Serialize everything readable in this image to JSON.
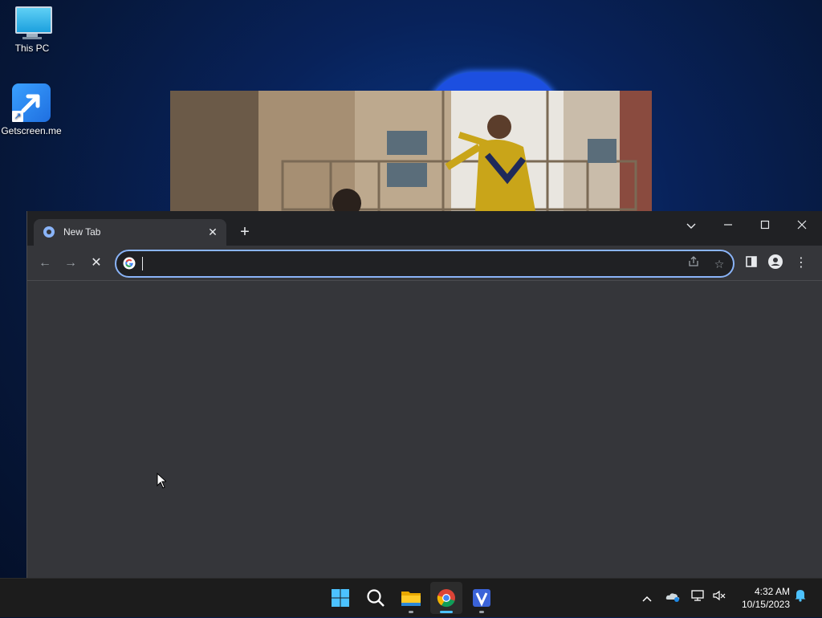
{
  "desktop": {
    "icons": [
      {
        "label": "This PC",
        "icon": "monitor-icon"
      },
      {
        "label": "Getscreen.me",
        "icon": "getscreen-arrow-icon"
      }
    ]
  },
  "browser": {
    "tab": {
      "title": "New Tab",
      "favicon": "chrome-newtab-icon",
      "close_glyph": "✕"
    },
    "new_tab_glyph": "+",
    "window_controls": {
      "tab_search": "⌄",
      "minimize": "—",
      "maximize": "☐",
      "close": "✕"
    },
    "toolbar": {
      "back": "←",
      "forward": "→",
      "stop": "✕"
    },
    "omnibox": {
      "value": "",
      "placeholder": "",
      "engine_icon": "google-g-icon"
    },
    "omnibox_actions": {
      "share": "share-icon",
      "bookmark": "☆"
    },
    "right_actions": {
      "side_panel": "side-panel-icon",
      "profile": "profile-icon",
      "menu": "⋮"
    },
    "accent_color": "#8ab4f8",
    "page_background": "#35363a"
  },
  "taskbar": {
    "apps": [
      {
        "name": "Start",
        "icon": "windows-start-icon"
      },
      {
        "name": "Search",
        "icon": "search-icon"
      },
      {
        "name": "File Explorer",
        "icon": "folder-icon"
      },
      {
        "name": "Google Chrome",
        "icon": "chrome-icon",
        "active": true
      },
      {
        "name": "VNC",
        "icon": "vnc-v-icon"
      }
    ],
    "tray": {
      "chevron": "^",
      "onedrive": "onedrive-icon",
      "network": "network-icon",
      "volume": "volume-muted-icon",
      "notifications": "bell-icon"
    },
    "clock": {
      "time": "4:32 AM",
      "date": "10/15/2023"
    }
  }
}
